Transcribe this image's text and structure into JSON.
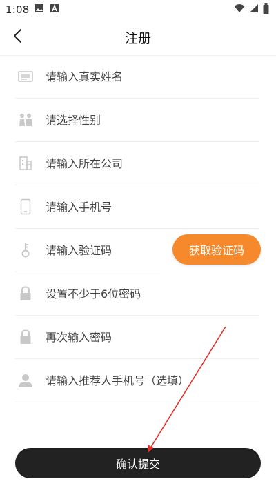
{
  "status_bar": {
    "time": "1:08",
    "icons": [
      "image-icon",
      "a-notification-icon",
      "wifi-icon",
      "cellular-signal-icon",
      "battery-icon"
    ]
  },
  "nav": {
    "back_icon": "chevron-left-icon",
    "title": "注册"
  },
  "form": {
    "fields": [
      {
        "icon": "id-card-icon",
        "placeholder": "请输入真实姓名"
      },
      {
        "icon": "gender-icon",
        "placeholder": "请选择性别"
      },
      {
        "icon": "building-icon",
        "placeholder": "请输入所在公司"
      },
      {
        "icon": "phone-icon",
        "placeholder": "请输入手机号"
      },
      {
        "icon": "key-icon",
        "placeholder": "请输入验证码"
      },
      {
        "icon": "lock-icon",
        "placeholder": "设置不少于6位密码"
      },
      {
        "icon": "lock-icon",
        "placeholder": "再次输入密码"
      },
      {
        "icon": "user-icon",
        "placeholder": "请输入推荐人手机号（选填）"
      }
    ],
    "get_code_label": "获取验证码"
  },
  "submit": {
    "label": "确认提交"
  },
  "colors": {
    "accent": "#f5892b",
    "submit_bg": "#222222",
    "icon_gray": "#c8c8c8",
    "annotation_arrow": "#e0302a"
  }
}
